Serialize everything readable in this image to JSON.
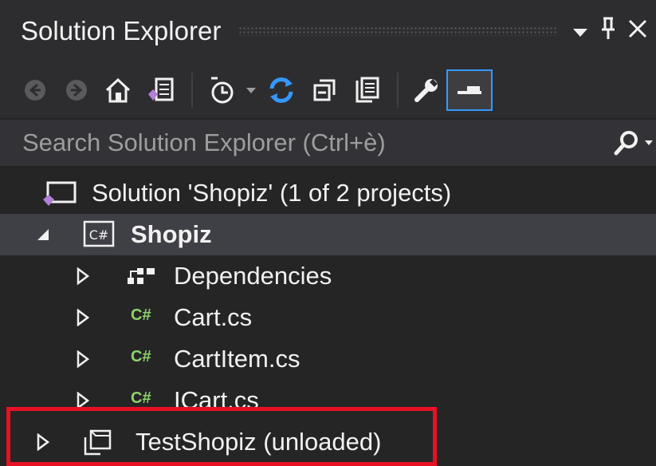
{
  "window": {
    "title": "Solution Explorer",
    "buttons": {
      "dropdown": "▾",
      "pin": "1",
      "close": "✕"
    }
  },
  "toolbar": {
    "items": [
      {
        "name": "back-icon"
      },
      {
        "name": "forward-icon"
      },
      {
        "name": "home-icon"
      },
      {
        "name": "switch-views-icon"
      },
      {
        "name": "pending-changes-filter-icon"
      },
      {
        "name": "sync-icon"
      },
      {
        "name": "collapse-all-icon"
      },
      {
        "name": "show-all-files-icon"
      },
      {
        "name": "properties-icon"
      },
      {
        "name": "preview-selected-items-icon"
      }
    ],
    "pending_dropdown": "▾"
  },
  "search": {
    "placeholder": "Search Solution Explorer (Ctrl+è)"
  },
  "tree": {
    "solution": "Solution 'Shopiz' (1 of 2 projects)",
    "project": "Shopiz",
    "dependencies": "Dependencies",
    "files": [
      "Cart.cs",
      "CartItem.cs",
      "ICart.cs"
    ],
    "unloaded_project": "TestShopiz (unloaded)",
    "cs_badge": "C#"
  },
  "colors": {
    "accent": "#3399ff",
    "highlight": "#e81123",
    "csharp": "#8dd36b"
  }
}
